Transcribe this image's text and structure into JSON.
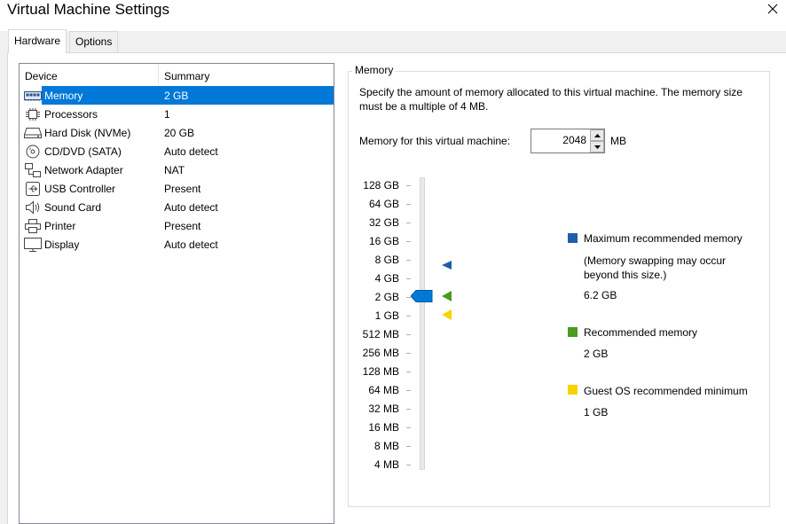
{
  "window": {
    "title": "Virtual Machine Settings"
  },
  "tabs": [
    {
      "label": "Hardware",
      "active": true
    },
    {
      "label": "Options",
      "active": false
    }
  ],
  "device_list": {
    "columns": [
      "Device",
      "Summary"
    ],
    "rows": [
      {
        "icon": "memory-icon",
        "name": "Memory",
        "summary": "2 GB",
        "selected": true
      },
      {
        "icon": "processor-icon",
        "name": "Processors",
        "summary": "1"
      },
      {
        "icon": "hard-disk-icon",
        "name": "Hard Disk (NVMe)",
        "summary": "20 GB"
      },
      {
        "icon": "cd-dvd-icon",
        "name": "CD/DVD (SATA)",
        "summary": "Auto detect"
      },
      {
        "icon": "network-adapter-icon",
        "name": "Network Adapter",
        "summary": "NAT"
      },
      {
        "icon": "usb-icon",
        "name": "USB Controller",
        "summary": "Present"
      },
      {
        "icon": "sound-icon",
        "name": "Sound Card",
        "summary": "Auto detect"
      },
      {
        "icon": "printer-icon",
        "name": "Printer",
        "summary": "Present"
      },
      {
        "icon": "display-icon",
        "name": "Display",
        "summary": "Auto detect"
      }
    ]
  },
  "memory_panel": {
    "group_title": "Memory",
    "description": "Specify the amount of memory allocated to this virtual machine. The memory size must be a multiple of 4 MB.",
    "field_label": "Memory for this virtual machine:",
    "field_value": "2048",
    "unit": "MB",
    "scale_labels": [
      "128 GB",
      "64 GB",
      "32 GB",
      "16 GB",
      "8 GB",
      "4 GB",
      "2 GB",
      "1 GB",
      "512 MB",
      "256 MB",
      "128 MB",
      "64 MB",
      "32 MB",
      "16 MB",
      "8 MB",
      "4 MB"
    ],
    "slider_value": "2 GB",
    "legend": {
      "maximum": {
        "label": "Maximum recommended memory",
        "note": "(Memory swapping may occur beyond this size.)",
        "value": "6.2 GB",
        "color": "#1e5ea8"
      },
      "recommended": {
        "label": "Recommended memory",
        "value": "2 GB",
        "color": "#4c9a1f"
      },
      "guest_min": {
        "label": "Guest OS recommended minimum",
        "value": "1 GB",
        "color": "#f5d400"
      }
    },
    "accent_color": "#0078d7"
  }
}
